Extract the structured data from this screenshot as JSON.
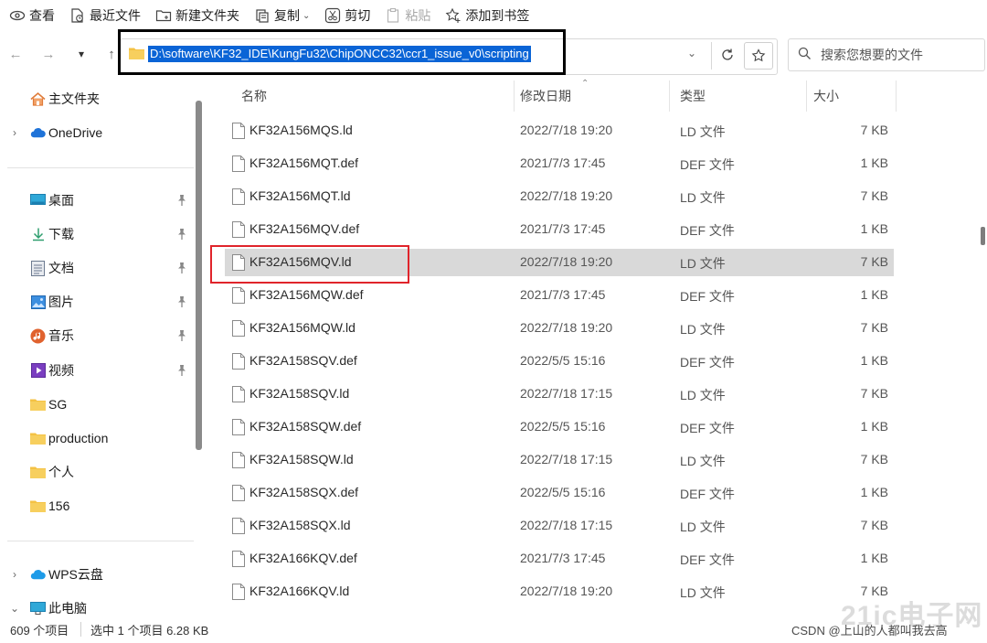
{
  "toolbar": {
    "view": "查看",
    "recent": "最近文件",
    "new_folder": "新建文件夹",
    "copy": "复制",
    "cut": "剪切",
    "paste": "粘贴",
    "bookmark": "添加到书签"
  },
  "address": {
    "path": "D:\\software\\KF32_IDE\\KungFu32\\ChipONCC32\\ccr1_issue_v0\\scripting"
  },
  "search": {
    "placeholder": "搜索您想要的文件"
  },
  "sidebar": {
    "items": [
      {
        "label": "主文件夹",
        "icon": "home-icon"
      },
      {
        "label": "OneDrive",
        "icon": "cloud-icon"
      },
      {
        "label": "桌面",
        "icon": "desktop-icon"
      },
      {
        "label": "下载",
        "icon": "download-icon"
      },
      {
        "label": "文档",
        "icon": "document-icon"
      },
      {
        "label": "图片",
        "icon": "picture-icon"
      },
      {
        "label": "音乐",
        "icon": "music-icon"
      },
      {
        "label": "视频",
        "icon": "video-icon"
      },
      {
        "label": "SG",
        "icon": "folder-icon"
      },
      {
        "label": "production",
        "icon": "folder-icon"
      },
      {
        "label": "个人",
        "icon": "folder-icon"
      },
      {
        "label": "156",
        "icon": "folder-icon"
      },
      {
        "label": "WPS云盘",
        "icon": "cloud-icon"
      },
      {
        "label": "此电脑",
        "icon": "computer-icon"
      }
    ]
  },
  "columns": {
    "name": "名称",
    "modified": "修改日期",
    "type": "类型",
    "size": "大小"
  },
  "files": [
    {
      "name": "KF32A156MQS.ld",
      "date": "2022/7/18 19:20",
      "type": "LD 文件",
      "size": "7 KB"
    },
    {
      "name": "KF32A156MQT.def",
      "date": "2021/7/3 17:45",
      "type": "DEF 文件",
      "size": "1 KB"
    },
    {
      "name": "KF32A156MQT.ld",
      "date": "2022/7/18 19:20",
      "type": "LD 文件",
      "size": "7 KB"
    },
    {
      "name": "KF32A156MQV.def",
      "date": "2021/7/3 17:45",
      "type": "DEF 文件",
      "size": "1 KB"
    },
    {
      "name": "KF32A156MQV.ld",
      "date": "2022/7/18 19:20",
      "type": "LD 文件",
      "size": "7 KB",
      "selected": true
    },
    {
      "name": "KF32A156MQW.def",
      "date": "2021/7/3 17:45",
      "type": "DEF 文件",
      "size": "1 KB"
    },
    {
      "name": "KF32A156MQW.ld",
      "date": "2022/7/18 19:20",
      "type": "LD 文件",
      "size": "7 KB"
    },
    {
      "name": "KF32A158SQV.def",
      "date": "2022/5/5 15:16",
      "type": "DEF 文件",
      "size": "1 KB"
    },
    {
      "name": "KF32A158SQV.ld",
      "date": "2022/7/18 17:15",
      "type": "LD 文件",
      "size": "7 KB"
    },
    {
      "name": "KF32A158SQW.def",
      "date": "2022/5/5 15:16",
      "type": "DEF 文件",
      "size": "1 KB"
    },
    {
      "name": "KF32A158SQW.ld",
      "date": "2022/7/18 17:15",
      "type": "LD 文件",
      "size": "7 KB"
    },
    {
      "name": "KF32A158SQX.def",
      "date": "2022/5/5 15:16",
      "type": "DEF 文件",
      "size": "1 KB"
    },
    {
      "name": "KF32A158SQX.ld",
      "date": "2022/7/18 17:15",
      "type": "LD 文件",
      "size": "7 KB"
    },
    {
      "name": "KF32A166KQV.def",
      "date": "2021/7/3 17:45",
      "type": "DEF 文件",
      "size": "1 KB"
    },
    {
      "name": "KF32A166KQV.ld",
      "date": "2022/7/18 19:20",
      "type": "LD 文件",
      "size": "7 KB"
    }
  ],
  "status": {
    "count": "609 个项目",
    "selection": "选中 1 个项目 6.28 KB",
    "watermark": "CSDN @上山的人都叫我去高"
  },
  "colors": {
    "selection_blue": "#0a64d6",
    "highlight_red": "#e0242b",
    "folder_yellow": "#f4c244"
  }
}
